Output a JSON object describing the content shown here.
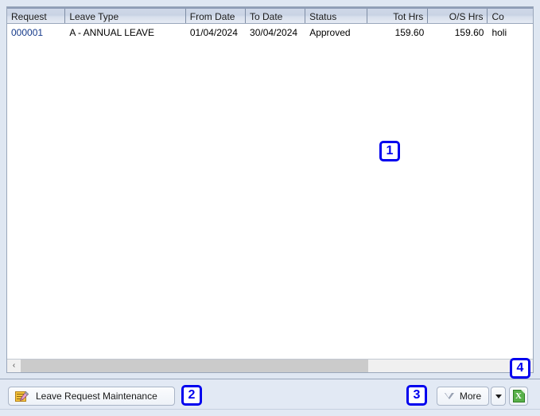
{
  "grid": {
    "columns": [
      {
        "key": "request",
        "label": "Request",
        "align": "left"
      },
      {
        "key": "leavetype",
        "label": "Leave Type",
        "align": "left"
      },
      {
        "key": "fromdate",
        "label": "From Date",
        "align": "left"
      },
      {
        "key": "todate",
        "label": "To Date",
        "align": "left"
      },
      {
        "key": "status",
        "label": "Status",
        "align": "left"
      },
      {
        "key": "tothrs",
        "label": "Tot Hrs",
        "align": "right"
      },
      {
        "key": "oshrs",
        "label": "O/S Hrs",
        "align": "right"
      },
      {
        "key": "comment",
        "label": "Co",
        "align": "left"
      }
    ],
    "rows": [
      {
        "request": "000001",
        "leavetype": "A - ANNUAL LEAVE",
        "fromdate": "01/04/2024",
        "todate": "30/04/2024",
        "status": "Approved",
        "tothrs": "159.60",
        "oshrs": "159.60",
        "comment": "holi"
      }
    ],
    "scrollbar": {
      "left_arrow": "‹"
    }
  },
  "bottom_bar": {
    "maintenance_button": {
      "label": "Leave Request Maintenance",
      "icon": "note-pencil-icon"
    },
    "more_button": {
      "label": "More",
      "icon": "triangle-down-outline-icon"
    },
    "more_dropdown": {
      "icon": "triangle-down-icon"
    },
    "excel_button": {
      "icon": "excel-export-icon",
      "glyph": "X"
    }
  },
  "markers": {
    "one": "1",
    "two": "2",
    "three": "3",
    "four": "4"
  },
  "colors": {
    "frame_background": "#dfe7f2",
    "header_gradient_top": "#cfd8e8",
    "grid_border": "#9aa7bb",
    "link_text": "#153a8a",
    "marker_blue": "#0000ee",
    "excel_green": "#59b14a",
    "note_yellow": "#f5c33c",
    "scroll_thumb": "#cbcbcb"
  }
}
